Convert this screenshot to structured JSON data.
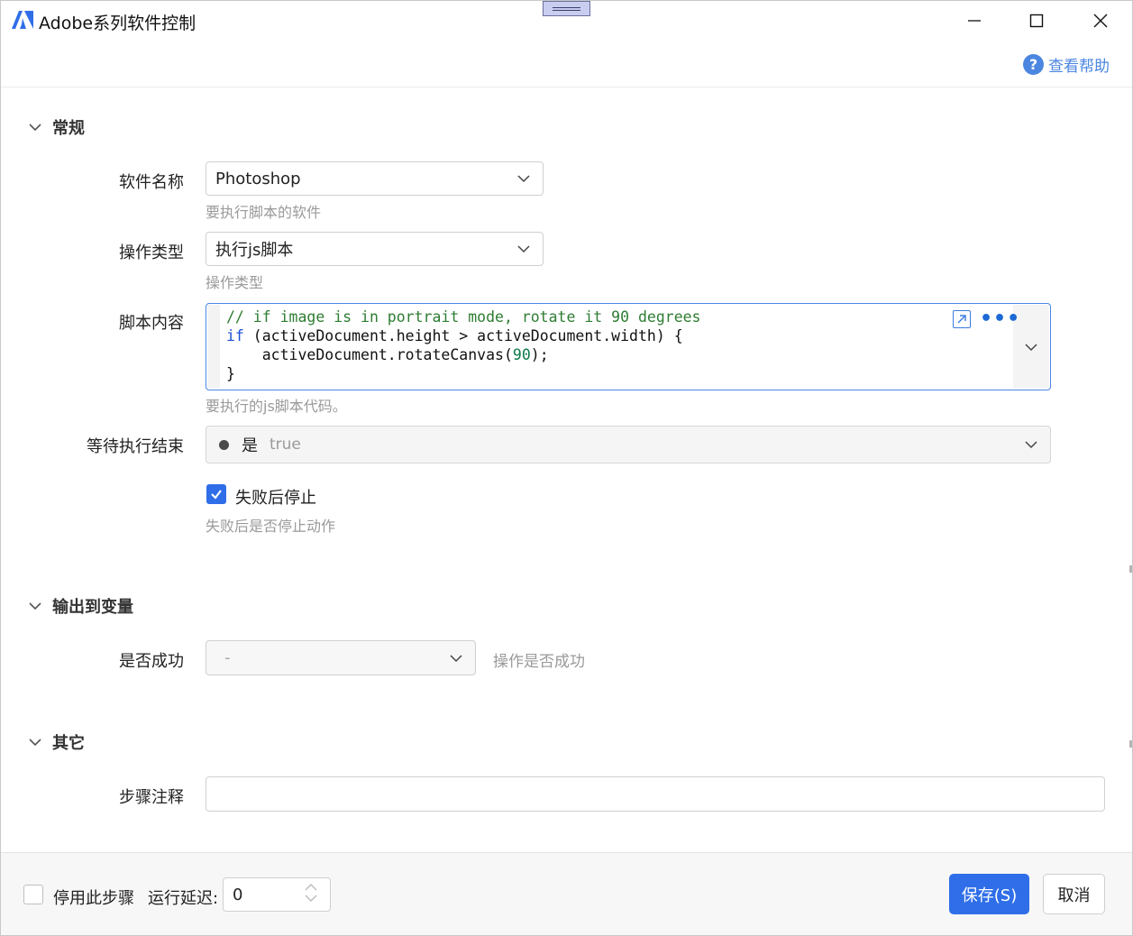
{
  "window": {
    "title": "Adobe系列软件控制"
  },
  "header": {
    "help_label": "查看帮助"
  },
  "sections": {
    "general": {
      "title": "常规",
      "software": {
        "label": "软件名称",
        "value": "Photoshop",
        "hint": "要执行脚本的软件"
      },
      "op_type": {
        "label": "操作类型",
        "value": "执行js脚本",
        "hint": "操作类型"
      },
      "script": {
        "label": "脚本内容",
        "hint": "要执行的js脚本代码。",
        "lines": {
          "l1": "// if image is in portrait mode, rotate it 90 degrees",
          "l2_kw": "if",
          "l2_rest": " (activeDocument.height > activeDocument.width) {",
          "l3_pre": "    activeDocument.rotateCanvas(",
          "l3_num": "90",
          "l3_post": ");",
          "l4": "}"
        }
      },
      "wait": {
        "label": "等待执行结束",
        "value_label": "是",
        "value": "true"
      },
      "stop_on_fail": {
        "label": "失败后停止",
        "checked": true,
        "hint": "失败后是否停止动作"
      }
    },
    "output": {
      "title": "输出到变量",
      "success": {
        "label": "是否成功",
        "value": "-",
        "hint": "操作是否成功"
      }
    },
    "other": {
      "title": "其它",
      "comment": {
        "label": "步骤注释",
        "value": ""
      }
    }
  },
  "footer": {
    "disable_label": "停用此步骤",
    "delay_label": "运行延迟:",
    "delay_value": "0",
    "save_label": "保存(S)",
    "cancel_label": "取消"
  },
  "colors": {
    "accent": "#2f6ee8",
    "help": "#4b86e0",
    "comment": "#2e7d32",
    "keyword": "#1b4fd6"
  }
}
